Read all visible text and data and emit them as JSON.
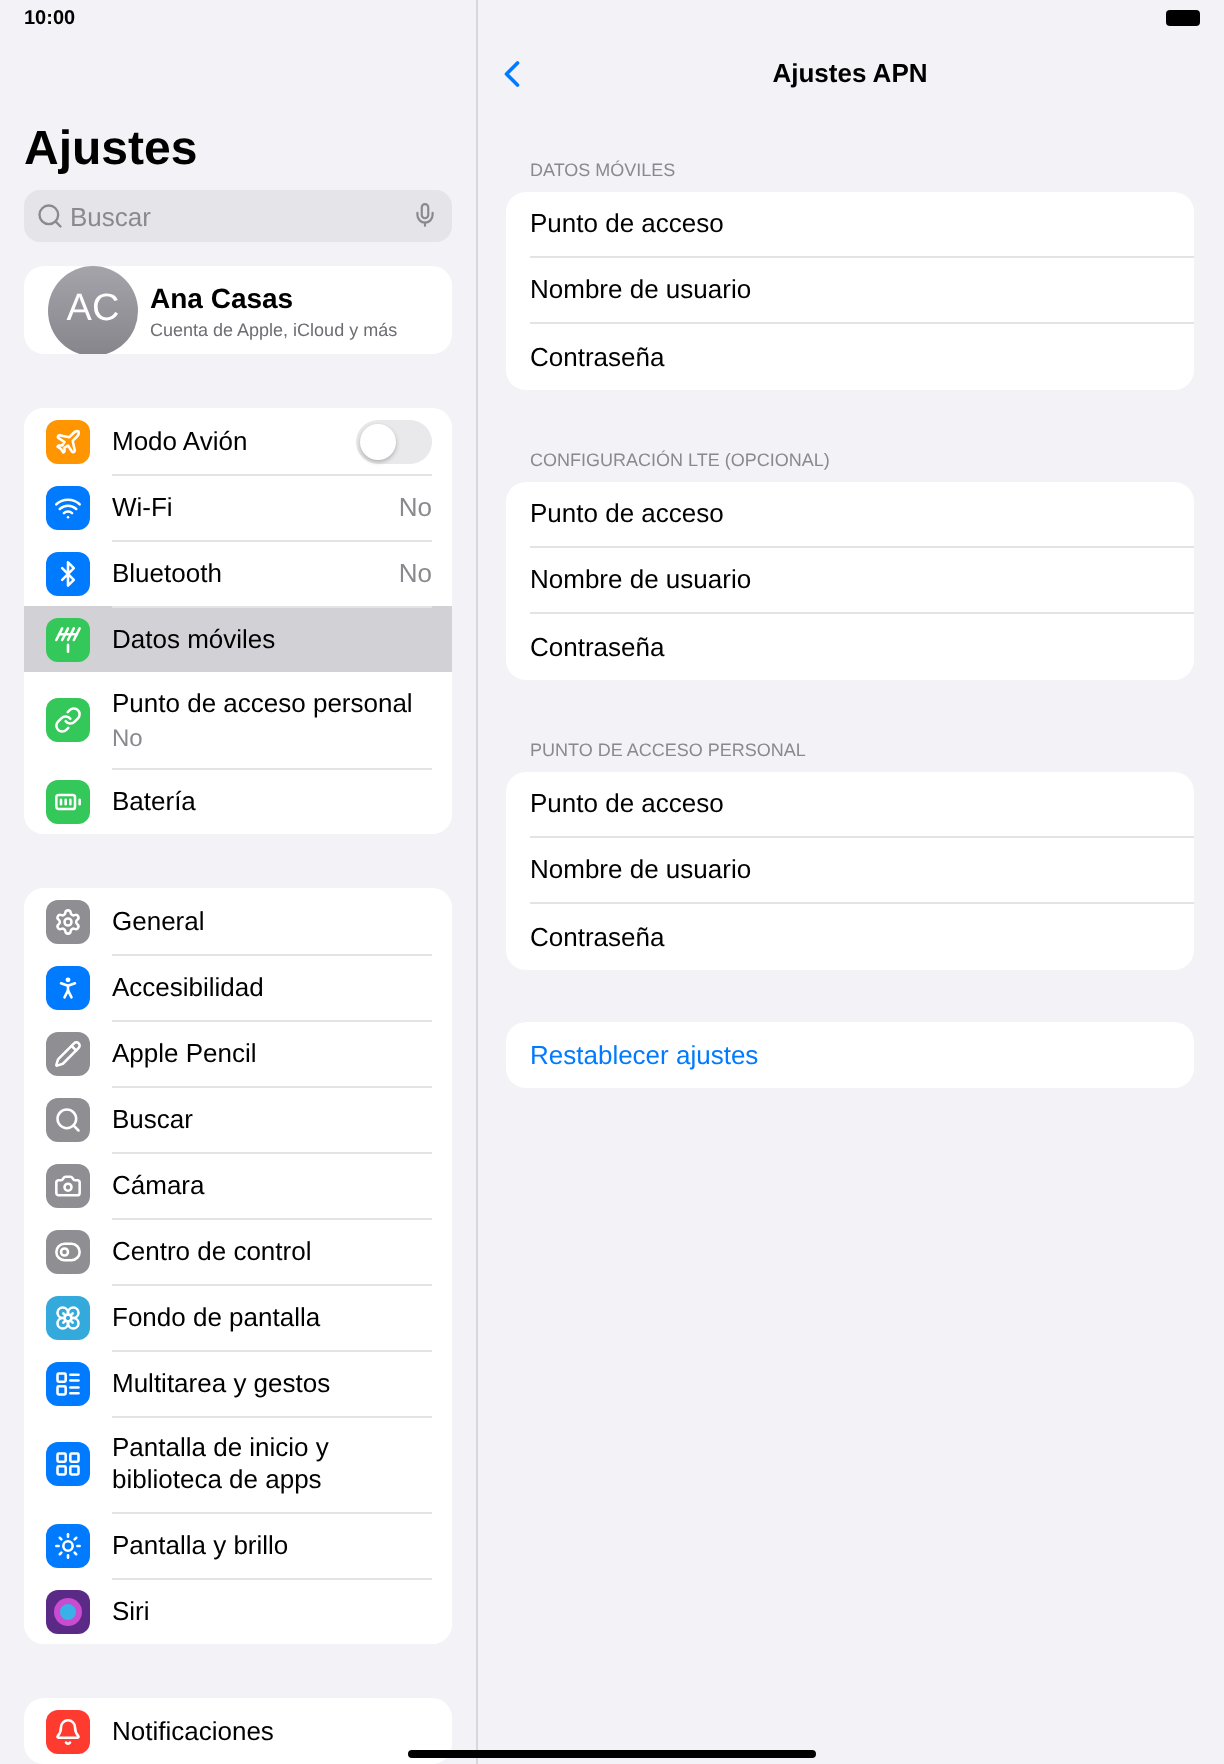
{
  "status_bar": {
    "time": "10:00"
  },
  "sidebar": {
    "title": "Ajustes",
    "search": {
      "placeholder": "Buscar"
    },
    "profile": {
      "initials": "AC",
      "name": "Ana Casas",
      "subtitle": "Cuenta de Apple, iCloud y más"
    },
    "groups": [
      {
        "items": [
          {
            "label": "Modo Avión",
            "on": false,
            "selected": false
          },
          {
            "label": "Wi-Fi",
            "value": "No",
            "selected": false
          },
          {
            "label": "Bluetooth",
            "value": "No",
            "selected": false
          },
          {
            "label": "Datos móviles",
            "selected": true
          },
          {
            "label": "Punto de acceso personal",
            "subtitle": "No",
            "selected": false
          },
          {
            "label": "Batería",
            "selected": false
          }
        ]
      },
      {
        "items": [
          {
            "label": "General",
            "selected": false
          },
          {
            "label": "Accesibilidad",
            "selected": false
          },
          {
            "label": "Apple Pencil",
            "selected": false
          },
          {
            "label": "Buscar",
            "selected": false
          },
          {
            "label": "Cámara",
            "selected": false
          },
          {
            "label": "Centro de control",
            "selected": false
          },
          {
            "label": "Fondo de pantalla",
            "selected": false
          },
          {
            "label": "Multitarea y gestos",
            "selected": false
          },
          {
            "label": "Pantalla de inicio y biblioteca de apps",
            "selected": false
          },
          {
            "label": "Pantalla y brillo",
            "selected": false
          },
          {
            "label": "Siri",
            "selected": false
          }
        ]
      },
      {
        "items": [
          {
            "label": "Notificaciones",
            "selected": false
          }
        ]
      }
    ]
  },
  "detail": {
    "title": "Ajustes APN",
    "sections": [
      {
        "header": "DATOS MÓVILES",
        "rows": [
          "Punto de acceso",
          "Nombre de usuario",
          "Contraseña"
        ]
      },
      {
        "header": "CONFIGURACIÓN LTE (OPCIONAL)",
        "rows": [
          "Punto de acceso",
          "Nombre de usuario",
          "Contraseña"
        ]
      },
      {
        "header": "PUNTO DE ACCESO PERSONAL",
        "rows": [
          "Punto de acceso",
          "Nombre de usuario",
          "Contraseña"
        ]
      }
    ],
    "reset": "Restablecer ajustes"
  }
}
